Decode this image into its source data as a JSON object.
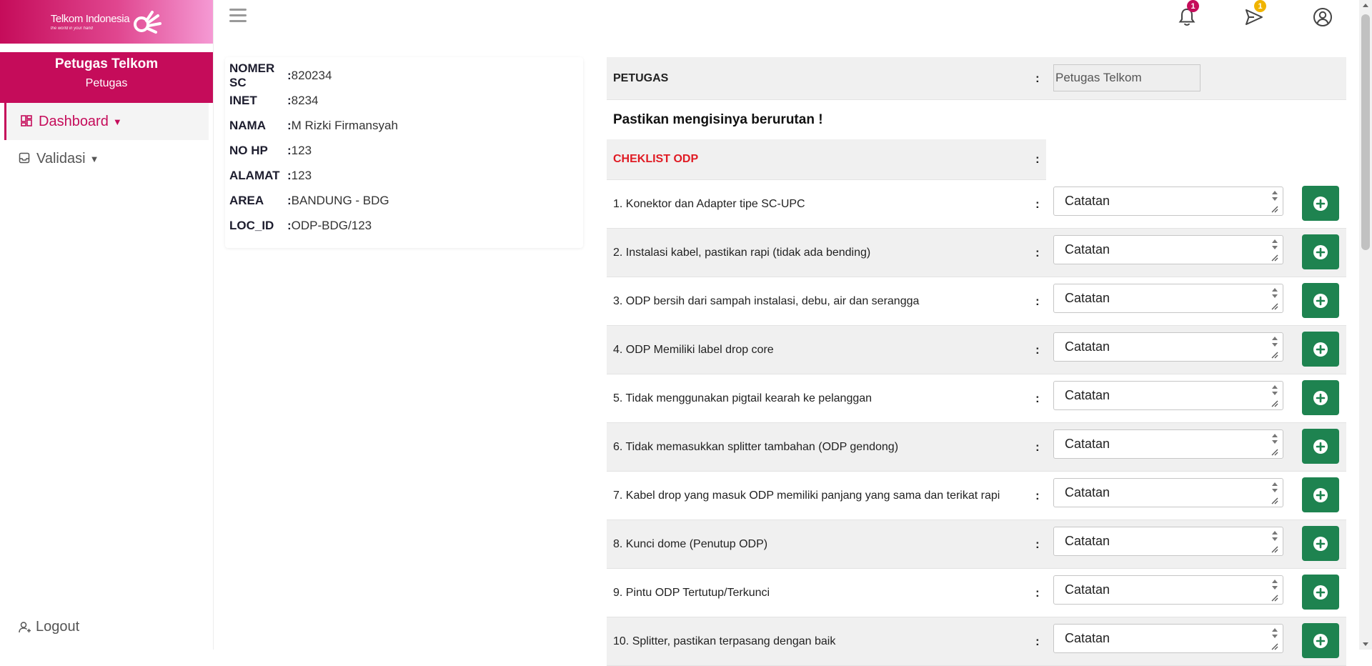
{
  "brand": {
    "name": "Telkom Indonesia",
    "tagline": "the world in your hand"
  },
  "user": {
    "name": "Petugas Telkom",
    "role": "Petugas"
  },
  "nav": {
    "dashboard": "Dashboard",
    "validasi": "Validasi",
    "logout": "Logout"
  },
  "topbar": {
    "notification_count": "1",
    "message_count": "1"
  },
  "colors": {
    "primary": "#c50c5a",
    "success": "#1e8350",
    "danger": "#e01b24"
  },
  "info": {
    "rows": [
      {
        "label": "NOMER SC",
        "value": "820234"
      },
      {
        "label": "INET",
        "value": "8234"
      },
      {
        "label": "NAMA",
        "value": "M Rizki Firmansyah"
      },
      {
        "label": "NO HP",
        "value": "123"
      },
      {
        "label": "ALAMAT",
        "value": "123"
      },
      {
        "label": "AREA",
        "value": "BANDUNG - BDG"
      },
      {
        "label": "LOC_ID",
        "value": "ODP-BDG/123"
      }
    ]
  },
  "form": {
    "petugas_label": "PETUGAS",
    "petugas_value": "Petugas Telkom",
    "warning": "Pastikan mengisinya berurutan !",
    "checklist_title": "CHEKLIST ODP",
    "note_placeholder": "Catatan",
    "items": [
      "1. Konektor dan Adapter tipe SC-UPC",
      "2. Instalasi kabel, pastikan rapi (tidak ada bending)",
      "3. ODP bersih dari sampah instalasi, debu, air dan serangga",
      "4. ODP Memiliki label drop core",
      "5. Tidak menggunakan pigtail kearah ke pelanggan",
      "6. Tidak memasukkan splitter tambahan (ODP gendong)",
      "7. Kabel drop yang masuk ODP memiliki panjang yang sama dan terikat rapi",
      "8. Kunci dome (Penutup ODP)",
      "9. Pintu ODP Tertutup/Terkunci",
      "10. Splitter, pastikan terpasang dengan baik"
    ]
  }
}
